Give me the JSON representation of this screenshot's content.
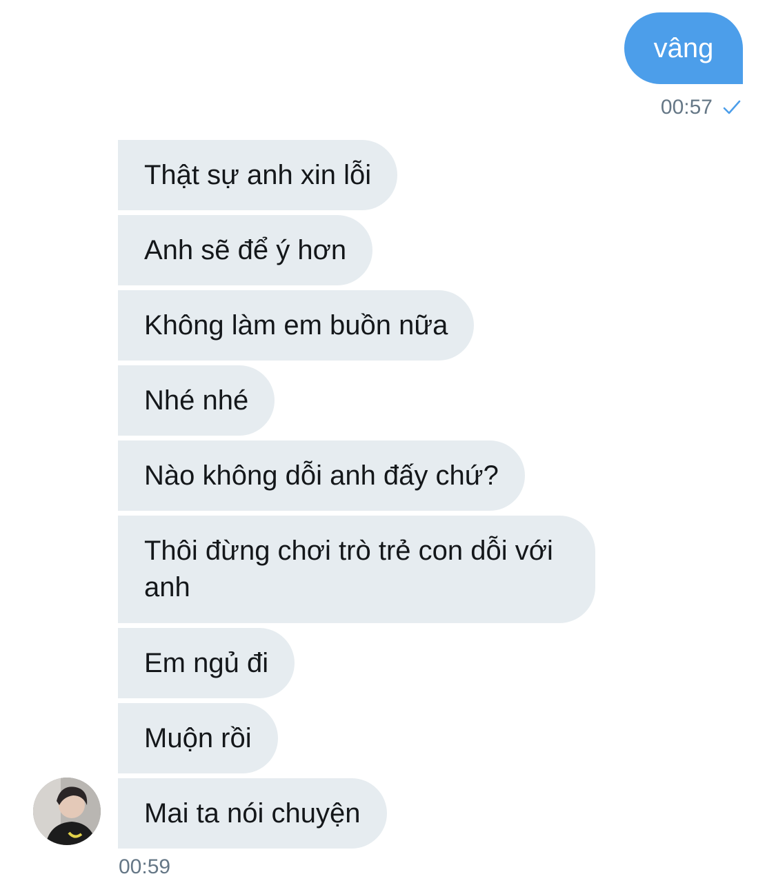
{
  "conversation": {
    "outgoing": {
      "text": "vâng",
      "time": "00:57",
      "status_icon": "check-icon"
    },
    "incoming": {
      "messages": [
        "Thật sự anh xin lỗi",
        "Anh sẽ để ý hơn",
        "Không làm em buồn nữa",
        "Nhé nhé",
        "Nào không dỗi anh đấy chứ?",
        "Thôi đừng chơi trò trẻ con dỗi với anh",
        "Em ngủ đi",
        "Muộn rồi",
        "Mai ta nói chuyện"
      ],
      "time": "00:59",
      "avatar_icon": "user-avatar"
    }
  },
  "colors": {
    "outgoing_bubble": "#4c9eea",
    "incoming_bubble": "#e6ecf0",
    "meta_text": "#657786"
  }
}
